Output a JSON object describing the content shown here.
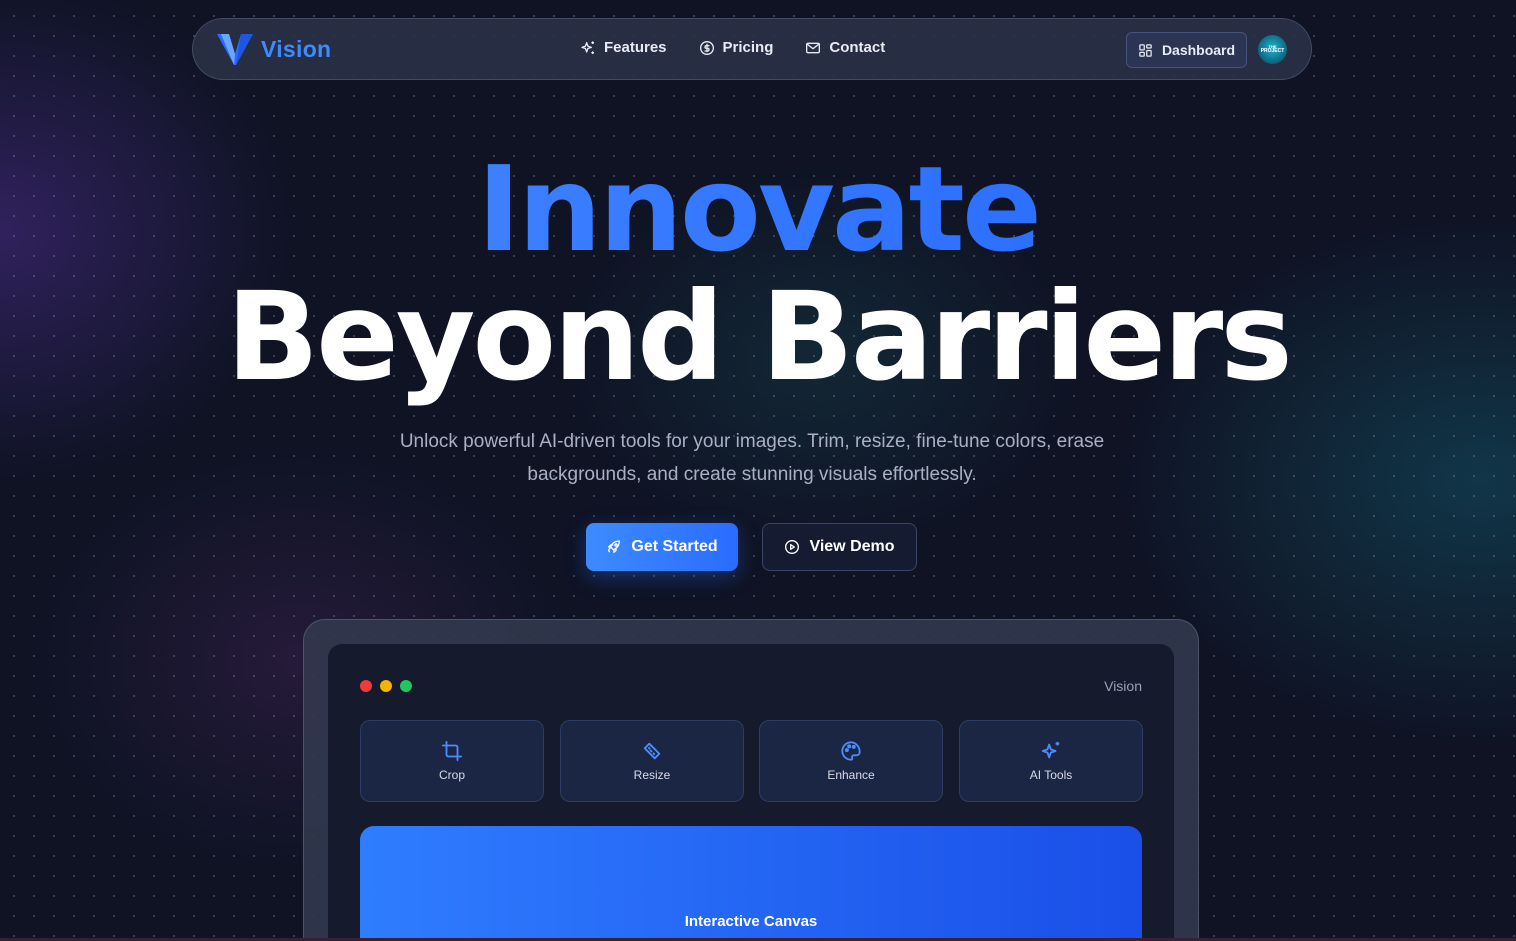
{
  "brand": {
    "name": "Vision"
  },
  "nav": {
    "links": [
      {
        "label": "Features",
        "icon": "sparkles-icon"
      },
      {
        "label": "Pricing",
        "icon": "dollar-circle-icon"
      },
      {
        "label": "Contact",
        "icon": "mail-icon"
      }
    ],
    "dashboard_label": "Dashboard",
    "avatar_text_top": "THE",
    "avatar_text_bottom": "PROJECT"
  },
  "hero": {
    "title_line1": "Innovate",
    "title_line2": "Beyond Barriers",
    "subtitle": "Unlock powerful AI-driven tools for your images. Trim, resize, fine-tune colors, erase backgrounds, and create stunning visuals effortlessly.",
    "primary_cta": "Get Started",
    "secondary_cta": "View Demo"
  },
  "mockup": {
    "window_title": "Vision",
    "tools": [
      {
        "label": "Crop",
        "icon": "crop-icon"
      },
      {
        "label": "Resize",
        "icon": "ruler-icon"
      },
      {
        "label": "Enhance",
        "icon": "palette-icon"
      },
      {
        "label": "AI Tools",
        "icon": "sparkles-icon"
      }
    ],
    "canvas_label": "Interactive Canvas"
  },
  "colors": {
    "accent": "#3d8bff",
    "background": "#0f1324",
    "traffic_red": "#ef3b3b",
    "traffic_yellow": "#f4b400",
    "traffic_green": "#22c55e"
  }
}
